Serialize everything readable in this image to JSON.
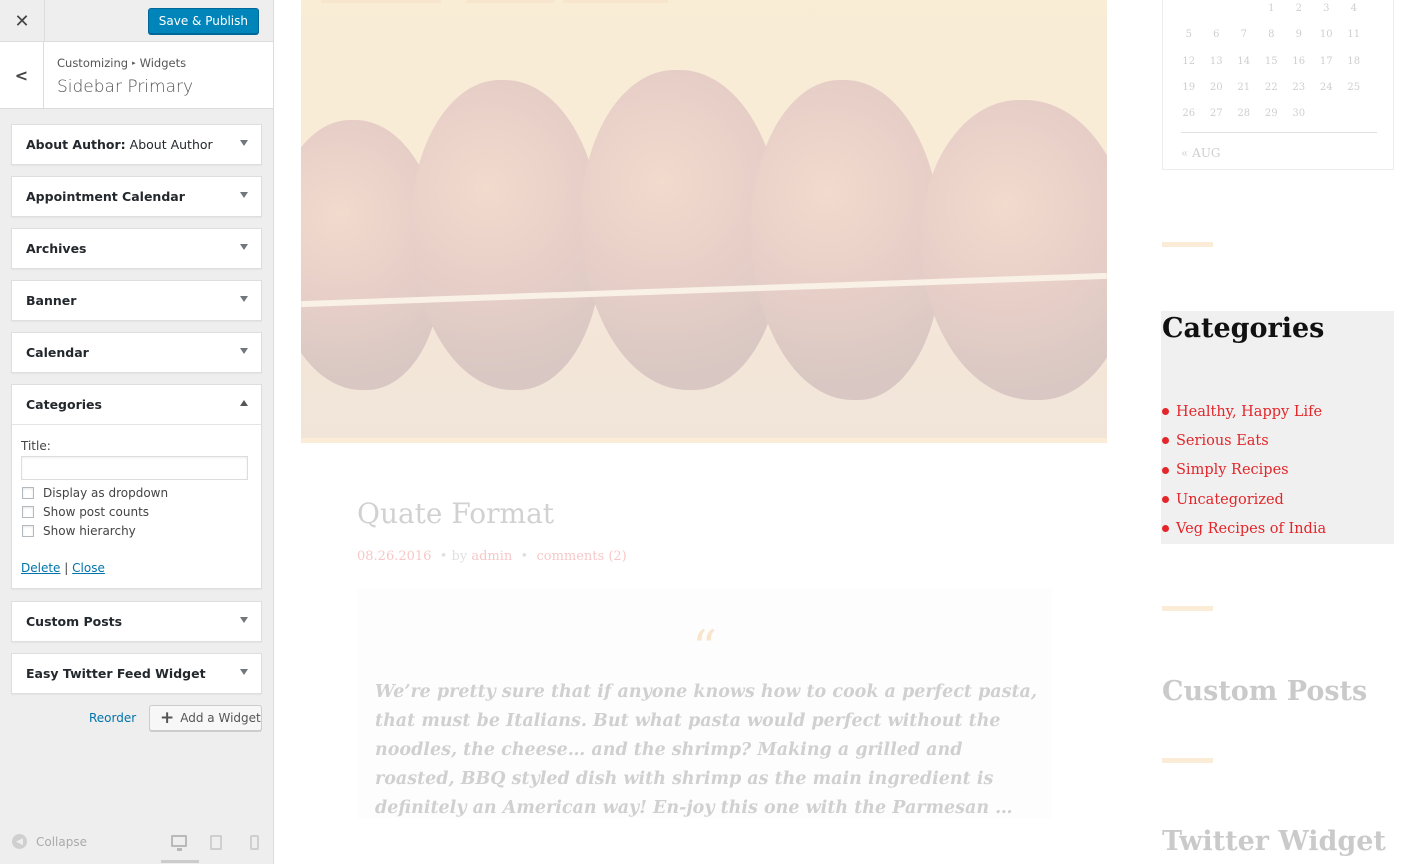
{
  "customizer": {
    "close_label": "✕",
    "save_label": "Save & Publish",
    "breadcrumb": {
      "root": "Customizing",
      "sep": "▸",
      "current": "Widgets"
    },
    "section_title": "Sidebar Primary",
    "widgets": [
      {
        "name": "About Author",
        "subtitle": "About Author",
        "expanded": false
      },
      {
        "name": "Appointment Calendar",
        "subtitle": "",
        "expanded": false
      },
      {
        "name": "Archives",
        "subtitle": "",
        "expanded": false
      },
      {
        "name": "Banner",
        "subtitle": "",
        "expanded": false
      },
      {
        "name": "Calendar",
        "subtitle": "",
        "expanded": false
      },
      {
        "name": "Categories",
        "subtitle": "",
        "expanded": true
      },
      {
        "name": "Custom Posts",
        "subtitle": "",
        "expanded": false
      },
      {
        "name": "Easy Twitter Feed Widget",
        "subtitle": "",
        "expanded": false
      }
    ],
    "categories_form": {
      "title_label": "Title:",
      "title_value": "",
      "options": [
        {
          "label": "Display as dropdown",
          "checked": false
        },
        {
          "label": "Show post counts",
          "checked": false
        },
        {
          "label": "Show hierarchy",
          "checked": false
        }
      ],
      "delete_label": "Delete",
      "link_sep": "|",
      "close_label": "Close"
    },
    "reorder_label": "Reorder",
    "add_widget_label": "Add a Widget",
    "collapse_label": "Collapse",
    "active_device": "desktop"
  },
  "preview": {
    "post": {
      "title": "Quate Format",
      "date": "08.26.2016",
      "by_label": "by",
      "author": "admin",
      "comments": "comments (2)",
      "quote": "We’re pretty sure that if anyone knows how to cook a perfect pasta, that must be Italians. But what pasta would perfect without the noodles, the cheese… and the shrimp? Making a grilled and roasted, BBQ styled dish with shrimp as the main ingredient is definitely an American way! En-joy this one with the Parmesan …"
    },
    "calendar": {
      "rows": [
        [
          "",
          "",
          "",
          "1",
          "2",
          "3",
          "4"
        ],
        [
          "5",
          "6",
          "7",
          "8",
          "9",
          "10",
          "11"
        ],
        [
          "12",
          "13",
          "14",
          "15",
          "16",
          "17",
          "18"
        ],
        [
          "19",
          "20",
          "21",
          "22",
          "23",
          "24",
          "25"
        ],
        [
          "26",
          "27",
          "28",
          "29",
          "30",
          "",
          ""
        ]
      ],
      "prev_link": "« AUG"
    },
    "categories": {
      "heading": "Categories",
      "items": [
        "Healthy, Happy Life",
        "Serious Eats",
        "Simply Recipes",
        "Uncategorized",
        "Veg Recipes of India"
      ]
    },
    "custom_posts_heading": "Custom Posts",
    "twitter_heading": "Twitter Widget",
    "colors": {
      "accent": "#f0b565",
      "link_red": "#e2262a",
      "wp_blue": "#0085ba"
    }
  }
}
